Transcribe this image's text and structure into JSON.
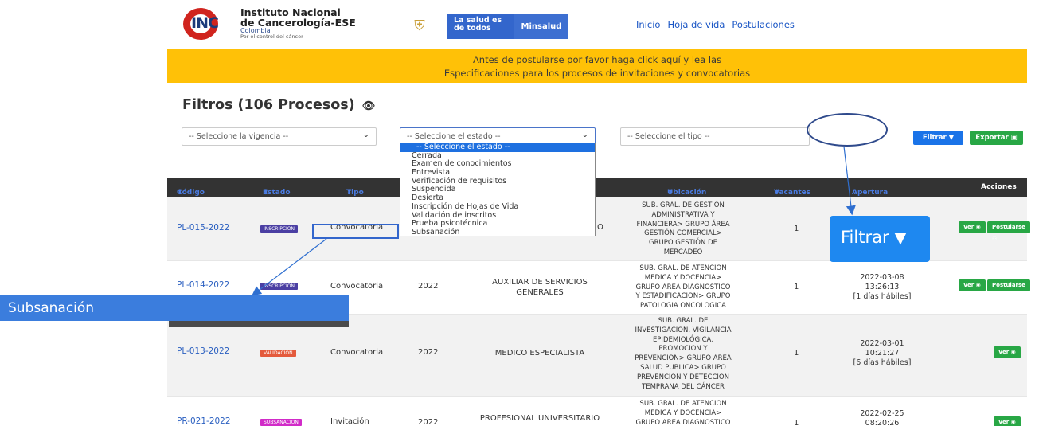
{
  "header": {
    "logo": {
      "mark": "INC",
      "line1": "Instituto Nacional",
      "line2": "de Cancerología-ESE",
      "line3": "Colombia",
      "line4": "Por el control del cáncer"
    },
    "gov": {
      "salud": "La salud es de todos",
      "minsalud": "Minsalud"
    },
    "nav": [
      "Inicio",
      "Hoja de vida",
      "Postulaciones"
    ]
  },
  "banner": {
    "line1": "Antes de postularse por favor haga click aquí y lea las",
    "line2": "Especificaciones para los procesos de invitaciones y convocatorias"
  },
  "filters": {
    "title": "Filtros (106 Procesos)",
    "vigencia": "-- Seleccione la vigencia --",
    "estado": "-- Seleccione el estado --",
    "tipo": "-- Seleccione el tipo --",
    "filtrar": "Filtrar",
    "exportar": "Exportar"
  },
  "dropdown_options": [
    "-- Seleccione el estado --",
    "Cerrada",
    "Examen de conocimientos",
    "Entrevista",
    "Verificación de requisitos",
    "Suspendida",
    "Desierta",
    "Inscripción de Hojas de Vida",
    "Validación de inscritos",
    "Prueba psicotécnica",
    "Subsanación"
  ],
  "table": {
    "headers": {
      "codigo": "Código",
      "estado": "Estado",
      "tipo": "Tipo",
      "ubicacion": "Ubicación",
      "vacantes": "Vacantes",
      "apertura": "Apertura",
      "acciones": "Acciones"
    },
    "rows": [
      {
        "codigo": "PL-015-2022",
        "estado": "INSCRIPCION",
        "tipo": "Convocatoria",
        "cargo_fragment": "O",
        "ubicacion": [
          "SUB. GRAL. DE GESTION",
          "ADMINISTRATIVA Y",
          "FINANCIERA> GRUPO ÁREA",
          "GESTIÓN COMERCIAL>",
          "GRUPO GESTIÓN DE",
          "MERCADEO"
        ],
        "vacantes": "1",
        "ver": "Ver",
        "postularse": "Postularse"
      },
      {
        "codigo": "PL-014-2022",
        "estado": "INSCRIPCION",
        "tipo": "Convocatoria",
        "vigencia": "2022",
        "cargo": [
          "AUXILIAR DE SERVICIOS",
          "GENERALES"
        ],
        "ubicacion": [
          "SUB. GRAL. DE ATENCION",
          "MEDICA Y DOCENCIA>",
          "GRUPO AREA DIAGNOSTICO",
          "Y ESTADIFICACION> GRUPO",
          "PATOLOGIA ONCOLOGICA"
        ],
        "vacantes": "1",
        "apertura": [
          "2022-03-08",
          "13:26:13",
          "[1 días hábiles]"
        ],
        "ver": "Ver",
        "postularse": "Postularse"
      },
      {
        "codigo": "PL-013-2022",
        "estado": "VALIDACION",
        "tipo": "Convocatoria",
        "vigencia": "2022",
        "cargo": [
          "MEDICO ESPECIALISTA"
        ],
        "ubicacion": [
          "SUB. GRAL. DE",
          "INVESTIGACION, VIGILANCIA",
          "EPIDEMIOLÓGICA,",
          "PROMOCION Y",
          "PREVENCION> GRUPO AREA",
          "SALUD PUBLICA> GRUPO",
          "PREVENCION Y DETECCION",
          "TEMPRANA DEL CÁNCER"
        ],
        "vacantes": "1",
        "apertura": [
          "2022-03-01",
          "10:21:27",
          "[6 días hábiles]"
        ],
        "ver": "Ver"
      },
      {
        "codigo": "PR-021-2022",
        "estado": "SUBSANACION",
        "tipo": "Invitación",
        "vigencia": "2022",
        "cargo": [
          "PROFESIONAL UNIVERSITARIO"
        ],
        "ubicacion": [
          "SUB. GRAL. DE ATENCION",
          "MEDICA Y DOCENCIA>",
          "GRUPO AREA DIAGNOSTICO"
        ],
        "vacantes": "1",
        "apertura": [
          "2022-02-25",
          "08:20:26"
        ],
        "ver": "Ver"
      }
    ]
  },
  "annotations": {
    "subsanacion_callout": "Subsanación",
    "filtrar_callout": "Filtrar"
  }
}
